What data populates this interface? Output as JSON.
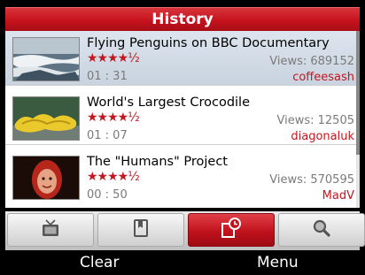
{
  "header": {
    "title": "History"
  },
  "videos": [
    {
      "title": "Flying Penguins on BBC Documentary",
      "rating": "★★★★½",
      "duration": "01 : 31",
      "views": "Views: 689152",
      "author": "coffeesash"
    },
    {
      "title": "World's Largest Crocodile",
      "rating": "★★★★½",
      "duration": "01 : 07",
      "views": "Views: 12505",
      "author": "diagonaluk"
    },
    {
      "title": "The \"Humans\" Project",
      "rating": "★★★★½",
      "duration": "00 : 50",
      "views": "Views: 570595",
      "author": "MadV"
    }
  ],
  "tabs": [
    {
      "icon": "tv-icon"
    },
    {
      "icon": "bookmark-icon"
    },
    {
      "icon": "history-icon",
      "active": true
    },
    {
      "icon": "search-icon"
    }
  ],
  "softkeys": {
    "left": "Clear",
    "right": "Menu"
  },
  "colors": {
    "accent": "#c4161e"
  }
}
